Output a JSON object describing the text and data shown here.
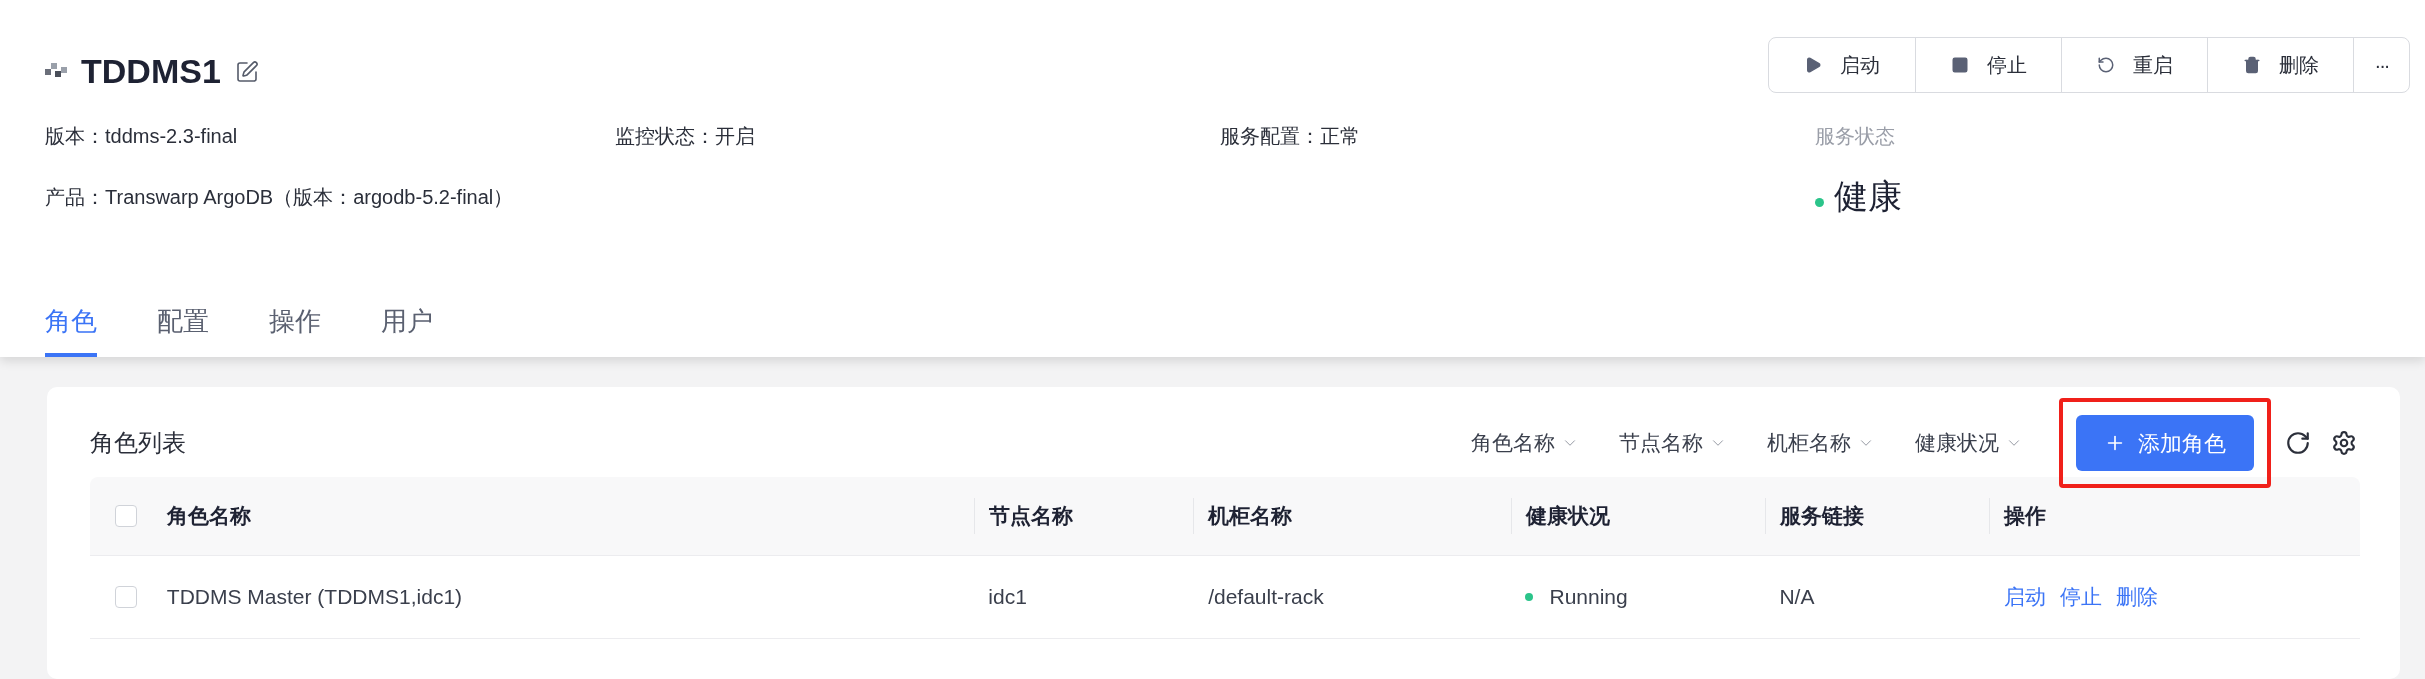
{
  "service": {
    "name": "TDDMS1"
  },
  "actions": [
    {
      "kind": "start",
      "label": "启动"
    },
    {
      "kind": "stop",
      "label": "停止"
    },
    {
      "kind": "restart",
      "label": "重启"
    },
    {
      "kind": "delete",
      "label": "删除"
    },
    {
      "kind": "more",
      "label": "···"
    }
  ],
  "info": [
    {
      "text": "版本：tddms-2.3-final"
    },
    {
      "text": "监控状态：开启"
    },
    {
      "text": "服务配置：正常"
    },
    {
      "text": "产品：Transwarp ArgoDB（版本：argodb-5.2-final）"
    }
  ],
  "status": {
    "label": "服务状态",
    "value": "健康",
    "color": "#2bc48a"
  },
  "tabs": [
    {
      "label": "角色",
      "selected": true
    },
    {
      "label": "配置",
      "selected": false
    },
    {
      "label": "操作",
      "selected": false
    },
    {
      "label": "用户",
      "selected": false
    }
  ],
  "list": {
    "title": "角色列表",
    "filters": [
      "角色名称",
      "节点名称",
      "机柜名称",
      "健康状况"
    ],
    "add_button": {
      "label": "添加角色",
      "highlighted": true
    }
  },
  "table": {
    "columns": [
      "角色名称",
      "节点名称",
      "机柜名称",
      "健康状况",
      "服务链接",
      "操作"
    ],
    "rows": [
      {
        "checked": false,
        "role": "TDDMS Master (TDDMS1,idc1)",
        "node": "idc1",
        "rack": "/default-rack",
        "health": "Running",
        "color": "#2bc48a",
        "link": "N/A",
        "ops": [
          "启动",
          "停止",
          "删除"
        ]
      }
    ],
    "all_checked": false
  }
}
